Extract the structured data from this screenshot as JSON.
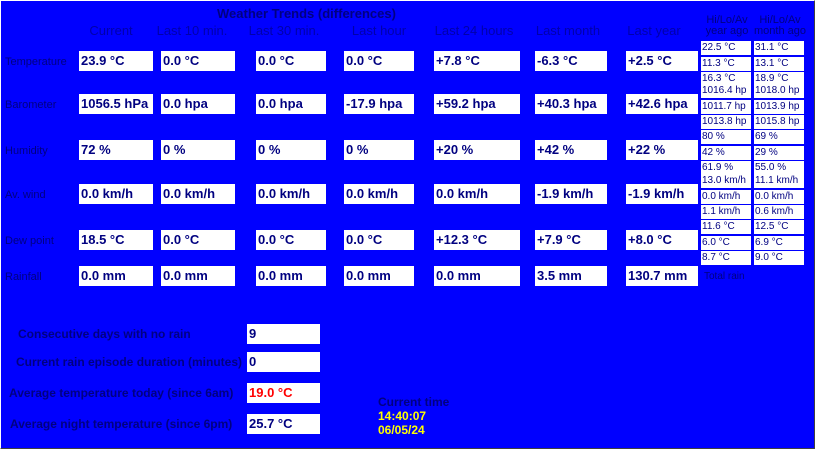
{
  "title": "Weather Trends (differences)",
  "columns": [
    "Current",
    "Last 10 min.",
    "Last 30 min.",
    "Last hour",
    "Last 24 hours",
    "Last month",
    "Last year"
  ],
  "hilo_headers": [
    [
      "Hi/Lo/Av",
      "year ago"
    ],
    [
      "Hi/Lo/Av",
      "month ago"
    ]
  ],
  "rows": [
    {
      "label": "Temperature",
      "values": [
        "23.9 °C",
        "0.0 °C",
        "0.0 °C",
        "0.0 °C",
        "+7.8 °C",
        "-6.3 °C",
        "+2.5 °C"
      ],
      "year_ago": [
        "22.5 °C",
        "11.3 °C",
        "16.3 °C"
      ],
      "month_ago": [
        "31.1 °C",
        "13.1 °C",
        "18.9 °C"
      ]
    },
    {
      "label": "Barometer",
      "values": [
        "1056.5 hPa",
        "0.0 hpa",
        "0.0 hpa",
        "-17.9 hpa",
        "+59.2 hpa",
        "+40.3 hpa",
        "+42.6 hpa"
      ],
      "year_ago": [
        "1016.4 hp",
        "1011.7 hp",
        "1013.8 hp"
      ],
      "month_ago": [
        "1018.0 hp",
        "1013.9 hp",
        "1015.8 hp"
      ]
    },
    {
      "label": "Humidity",
      "values": [
        "72 %",
        " 0 %",
        " 0 %",
        " 0 %",
        "+20 %",
        "+42 %",
        "+22 %"
      ],
      "year_ago": [
        "80 %",
        "42 %",
        "61.9 %"
      ],
      "month_ago": [
        "69 %",
        "29 %",
        "55.0 %"
      ]
    },
    {
      "label": "Av. wind",
      "values": [
        "0.0 km/h",
        "0.0 km/h",
        "0.0 km/h",
        "0.0 km/h",
        "0.0 km/h",
        "-1.9 km/h",
        "-1.9 km/h"
      ],
      "year_ago": [
        "13.0 km/h",
        "0.0 km/h",
        "1.1 km/h"
      ],
      "month_ago": [
        "11.1 km/h",
        "0.0 km/h",
        "0.6 km/h"
      ]
    },
    {
      "label": "Dew point",
      "values": [
        "18.5 °C",
        "0.0 °C",
        "0.0 °C",
        "0.0 °C",
        "+12.3 °C",
        "+7.9 °C",
        "+8.0 °C"
      ],
      "year_ago": [
        "11.6 °C",
        "6.0 °C",
        "8.7 °C"
      ],
      "month_ago": [
        "12.5 °C",
        "6.9 °C",
        "9.0 °C"
      ]
    },
    {
      "label": "Rainfall",
      "values": [
        "0.0 mm",
        "0.0 mm",
        "0.0 mm",
        "0.0 mm",
        "0.0 mm",
        "3.5 mm",
        "130.7 mm"
      ],
      "total_label": "Total rain"
    }
  ],
  "stats": [
    {
      "label": "Consecutive days with no rain",
      "value": "9",
      "color": "#000080"
    },
    {
      "label": "Current rain episode duration (minutes)",
      "value": "0",
      "color": "#000080"
    },
    {
      "label": "Average temperature today (since 6am)",
      "value": "19.0 °C",
      "color": "#ff0000"
    },
    {
      "label": "Average night temperature (since 6pm)",
      "value": "25.7 °C",
      "color": "#000080"
    }
  ],
  "current_time": {
    "label": "Current time",
    "time": "14:40:07",
    "date": "06/05/24"
  },
  "colors": {
    "background": "#0000ff",
    "text": "#000080",
    "highlight": "#ffff00",
    "alert": "#ff0000"
  }
}
